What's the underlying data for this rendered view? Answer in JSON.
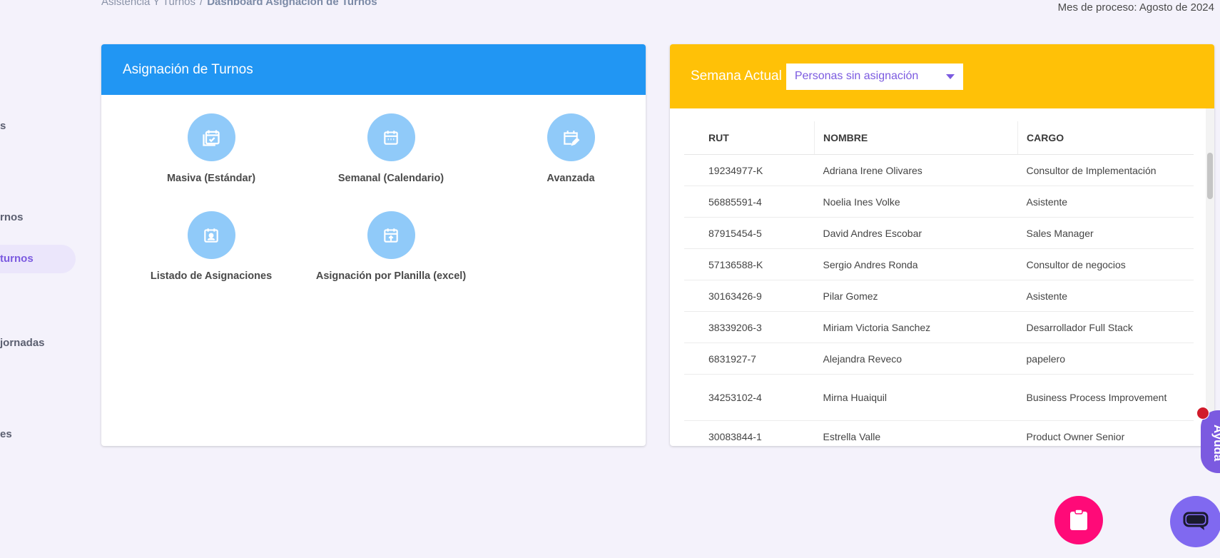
{
  "breadcrumb": {
    "parent": "Asistencia Y Turnos",
    "separator": "/",
    "current": "Dashboard Asignación de Turnos"
  },
  "period": "Mes de proceso: Agosto de 2024",
  "sidebar": {
    "items": [
      {
        "label": "s"
      },
      {
        "label": "rnos"
      },
      {
        "label": "turnos",
        "active": true
      },
      {
        "label": "jornadas"
      },
      {
        "label": "es"
      }
    ]
  },
  "assign_card": {
    "title": "Asignación de Turnos",
    "header_color": "#2196f3",
    "options": [
      {
        "label": "Masiva (Estándar)",
        "icon": "calendar-check-stack-icon"
      },
      {
        "label": "Semanal (Calendario)",
        "icon": "calendar-week-icon"
      },
      {
        "label": "Avanzada",
        "icon": "calendar-edit-icon"
      },
      {
        "label": "Listado de Asignaciones",
        "icon": "calendar-person-icon"
      },
      {
        "label": "Asignación por Planilla (excel)",
        "icon": "calendar-upload-icon"
      }
    ]
  },
  "week_card": {
    "title": "Semana Actual",
    "header_color": "#ffc107",
    "select_value": "Personas sin asignación",
    "columns": [
      "RUT",
      "NOMBRE",
      "CARGO"
    ],
    "rows": [
      [
        "19234977-K",
        "Adriana Irene Olivares",
        "Consultor de Implementación"
      ],
      [
        "56885591-4",
        "Noelia Ines Volke",
        "Asistente"
      ],
      [
        "87915454-5",
        "David Andres Escobar",
        "Sales Manager"
      ],
      [
        "57136588-K",
        "Sergio Andres Ronda",
        "Consultor de negocios"
      ],
      [
        "30163426-9",
        "Pilar Gomez",
        "Asistente"
      ],
      [
        "38339206-3",
        "Miriam Victoria Sanchez",
        "Desarrollador Full Stack"
      ],
      [
        "6831927-7",
        "Alejandra Reveco",
        "papelero"
      ],
      [
        "34253102-4",
        "Mirna Huaiquil",
        "Business Process Improvement"
      ],
      [
        "30083844-1",
        "Estrella Valle",
        "Product Owner Senior"
      ]
    ]
  },
  "help_tab": {
    "label": "Ayuda"
  },
  "fabs": {
    "clipboard_icon": "clipboard-icon",
    "chat_icon": "chat-icon"
  }
}
